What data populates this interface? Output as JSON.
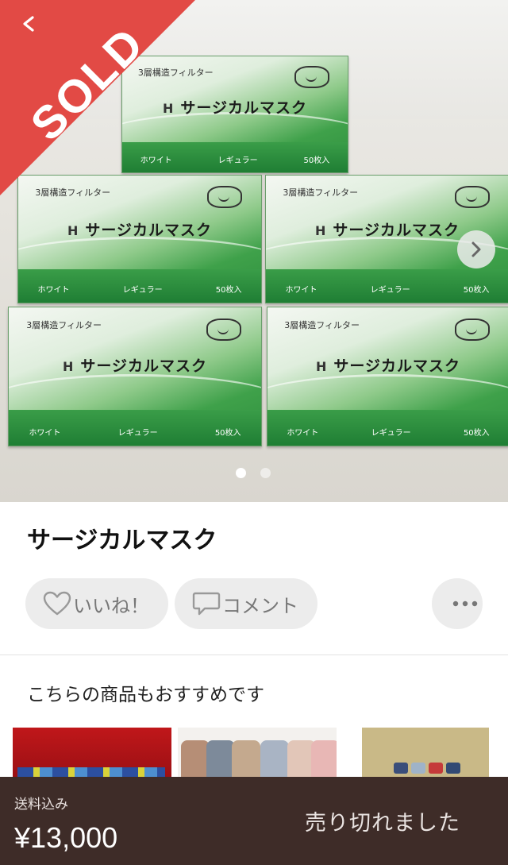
{
  "product_image": {
    "sold_label": "SOLD",
    "boxes": [
      {
        "top_label": "3層構造フィルター",
        "name": "サージカルマスク",
        "color": "ホワイト",
        "size": "レギュラー",
        "count": "50枚入"
      },
      {
        "top_label": "3層構造フィルター",
        "name": "サージカルマスク",
        "color": "ホワイト",
        "size": "レギュラー",
        "count": "50枚入"
      },
      {
        "top_label": "3層構造フィルター",
        "name": "サージカルマスク",
        "color": "ホワイト",
        "size": "レギュラー",
        "count": "50枚入"
      },
      {
        "top_label": "3層構造フィルター",
        "name": "サージカルマスク",
        "color": "ホワイト",
        "size": "レギュラー",
        "count": "50枚入"
      },
      {
        "top_label": "3層構造フィルター",
        "name": "サージカルマスク",
        "color": "ホワイト",
        "size": "レギュラー",
        "count": "50枚入"
      }
    ],
    "page_count": 2,
    "current_page": 1,
    "sold_color": "#e24a45"
  },
  "item": {
    "title": "サージカルマスク"
  },
  "actions": {
    "like_label": "いいね！",
    "comment_label": "コメント",
    "more_icon": "ellipsis-icon"
  },
  "recommendations": {
    "heading": "こちらの商品もおすすめです"
  },
  "footer": {
    "shipping_label": "送料込み",
    "price": "¥13,000",
    "status": "売り切れました",
    "background_color": "#3e2c28"
  }
}
